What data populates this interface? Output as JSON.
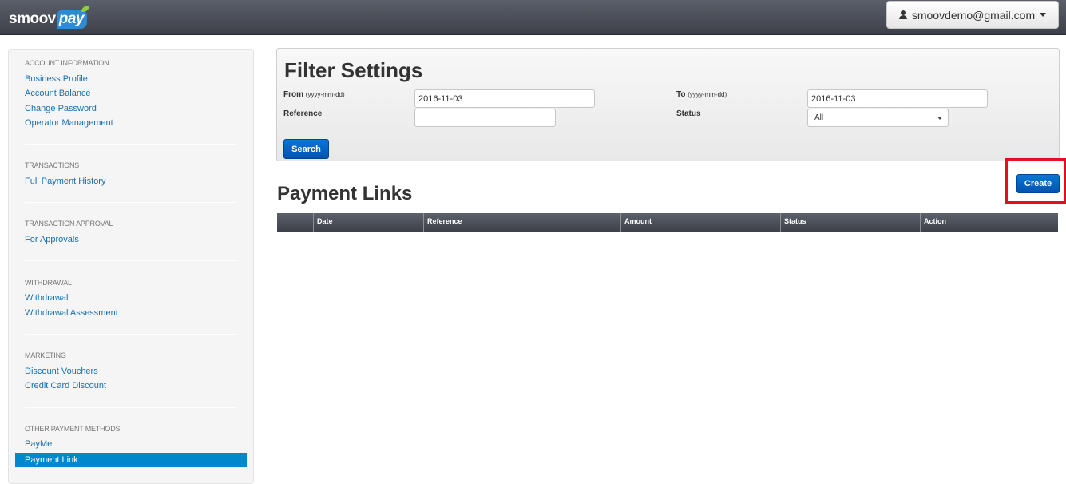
{
  "brand": {
    "logo_part1": "smoov",
    "logo_part2": "pay"
  },
  "user_menu": {
    "email": "smoovdemo@gmail.com"
  },
  "sidebar": {
    "sections": [
      {
        "header": "ACCOUNT INFORMATION",
        "items": [
          "Business Profile",
          "Account Balance",
          "Change Password",
          "Operator Management"
        ]
      },
      {
        "header": "TRANSACTIONS",
        "items": [
          "Full Payment History"
        ]
      },
      {
        "header": "TRANSACTION APPROVAL",
        "items": [
          "For Approvals"
        ]
      },
      {
        "header": "WITHDRAWAL",
        "items": [
          "Withdrawal",
          "Withdrawal Assessment"
        ]
      },
      {
        "header": "MARKETING",
        "items": [
          "Discount Vouchers",
          "Credit Card Discount"
        ]
      },
      {
        "header": "OTHER PAYMENT METHODS",
        "items": [
          "PayMe",
          "Payment Link"
        ]
      }
    ],
    "active_item": "Payment Link"
  },
  "filter": {
    "title": "Filter Settings",
    "from_label": "From",
    "from_hint": "(yyyy-mm-dd)",
    "from_value": "2016-11-03",
    "to_label": "To",
    "to_hint": "(yyyy-mm-dd)",
    "to_value": "2016-11-03",
    "reference_label": "Reference",
    "reference_value": "",
    "status_label": "Status",
    "status_value": "All",
    "search_button": "Search"
  },
  "payment_links": {
    "title": "Payment Links",
    "create_button": "Create",
    "columns": [
      "",
      "Date",
      "Reference",
      "Amount",
      "Status",
      "Action"
    ],
    "rows": []
  },
  "colors": {
    "primary": "#0066cc",
    "active_sidebar": "#0088cc",
    "highlight": "#e01020",
    "navbar": "#4a4d55"
  }
}
